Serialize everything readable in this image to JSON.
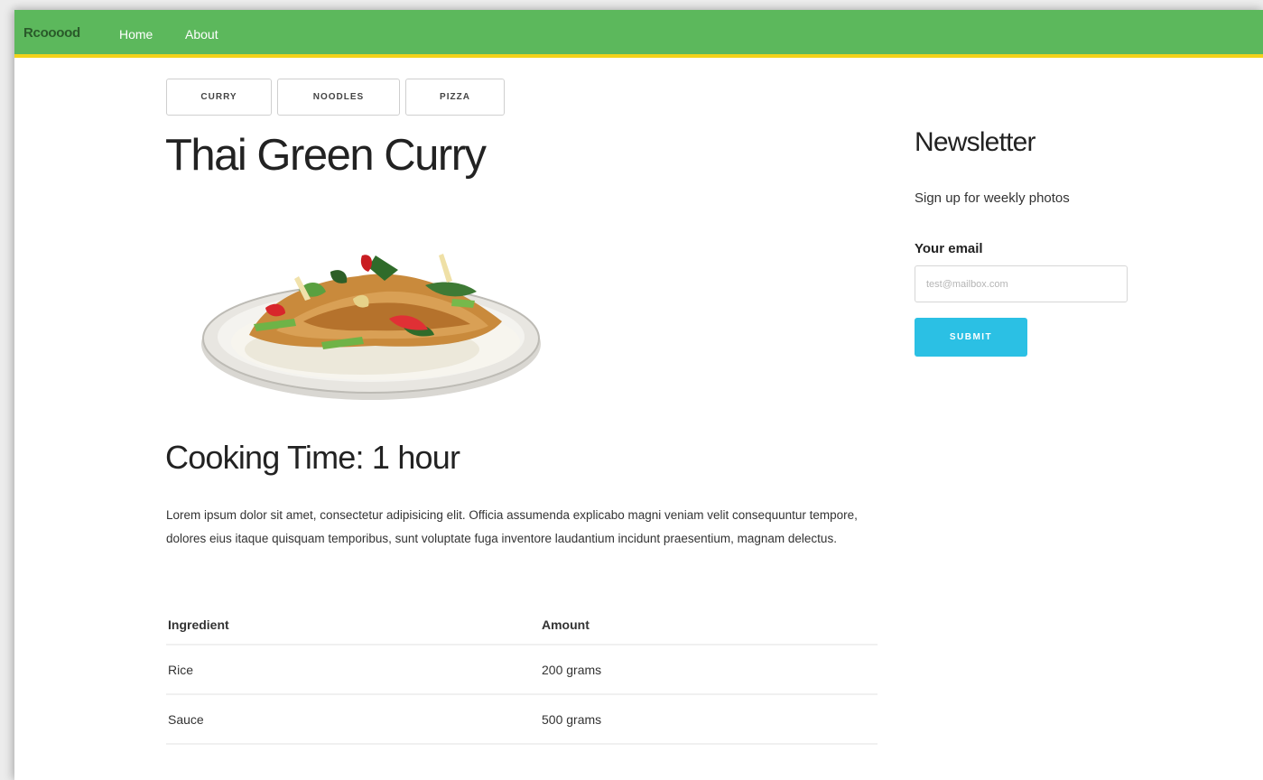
{
  "navbar": {
    "brand": "Rcooood",
    "links": [
      "Home",
      "About"
    ]
  },
  "category_tabs": [
    "CURRY",
    "NOODLES",
    "PIZZA"
  ],
  "recipe": {
    "title": "Thai Green Curry",
    "cooking_time": "Cooking Time: 1 hour",
    "description": "Lorem ipsum dolor sit amet, consectetur adipisicing elit. Officia assumenda explicabo magni veniam velit consequuntur tempore, dolores eius itaque quisquam temporibus, sunt voluptate fuga inventore laudantium incidunt praesentium, magnam delectus.",
    "table": {
      "headers": [
        "Ingredient",
        "Amount"
      ],
      "rows": [
        [
          "Rice",
          "200 grams"
        ],
        [
          "Sauce",
          "500 grams"
        ]
      ]
    }
  },
  "newsletter": {
    "title": "Newsletter",
    "subtitle": "Sign up for weekly photos",
    "email_label": "Your email",
    "email_placeholder": "test@mailbox.com",
    "submit_label": "SUBMIT"
  },
  "colors": {
    "navbar": "#5cb85c",
    "navbar_border": "#f2d21b",
    "submit": "#2bc0e4"
  }
}
